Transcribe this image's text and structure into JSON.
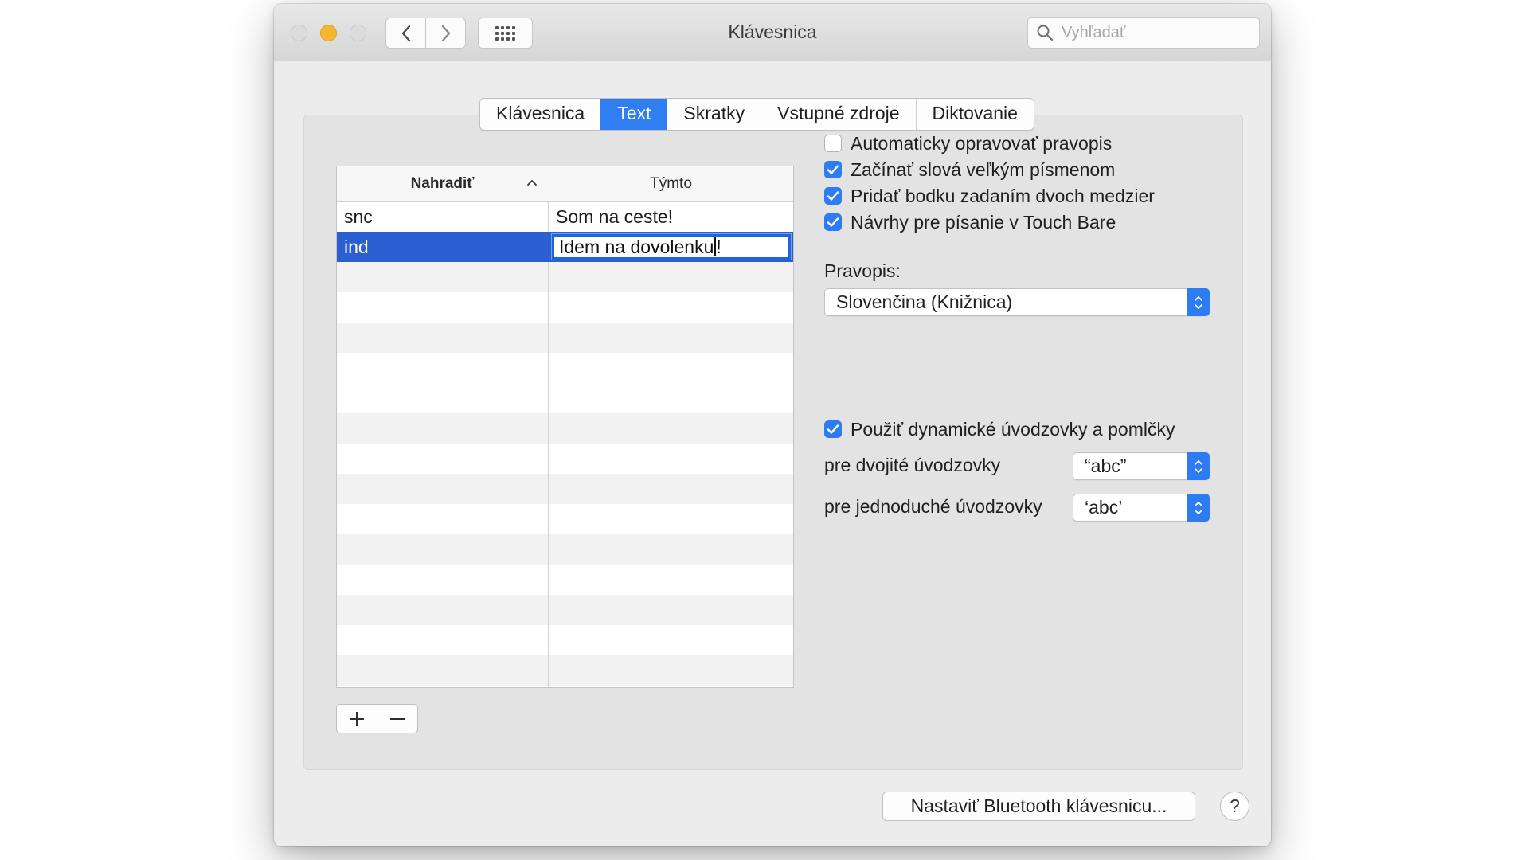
{
  "window": {
    "title": "Klávesnica",
    "search_placeholder": "Vyhľadať"
  },
  "tabs": [
    {
      "label": "Klávesnica",
      "active": false
    },
    {
      "label": "Text",
      "active": true
    },
    {
      "label": "Skratky",
      "active": false
    },
    {
      "label": "Vstupné zdroje",
      "active": false
    },
    {
      "label": "Diktovanie",
      "active": false
    }
  ],
  "table": {
    "columns": [
      "Nahradiť",
      "Týmto"
    ],
    "rows": [
      {
        "replace": "snc",
        "with": "Som na ceste!",
        "selected": false
      },
      {
        "replace": "ind",
        "with": "Idem na dovolenku!",
        "selected": true,
        "editing": true
      }
    ],
    "add_label": "+",
    "remove_label": "—"
  },
  "options": {
    "autocorrect": {
      "label": "Automaticky opravovať pravopis",
      "checked": false
    },
    "capitalize": {
      "label": "Začínať slová veľkým písmenom",
      "checked": true
    },
    "period": {
      "label": "Pridať bodku zadaním dvoch medzier",
      "checked": true
    },
    "touchbar": {
      "label": "Návrhy pre písanie v Touch Bare",
      "checked": true
    }
  },
  "spelling": {
    "label": "Pravopis:",
    "value": "Slovenčina (Knižnica)"
  },
  "quotes": {
    "smart": {
      "label": "Použiť dynamické úvodzovky a pomlčky",
      "checked": true
    },
    "double_label": "pre dvojité úvodzovky",
    "double_value": "“abc”",
    "single_label": "pre jednoduché úvodzovky",
    "single_value": "‘abc’"
  },
  "footer": {
    "bluetooth_button": "Nastaviť Bluetooth klávesnicu...",
    "help_label": "?"
  },
  "colors": {
    "accent": "#2e7cf4",
    "selection": "#2c5fd1",
    "minimize": "#f5b731"
  }
}
